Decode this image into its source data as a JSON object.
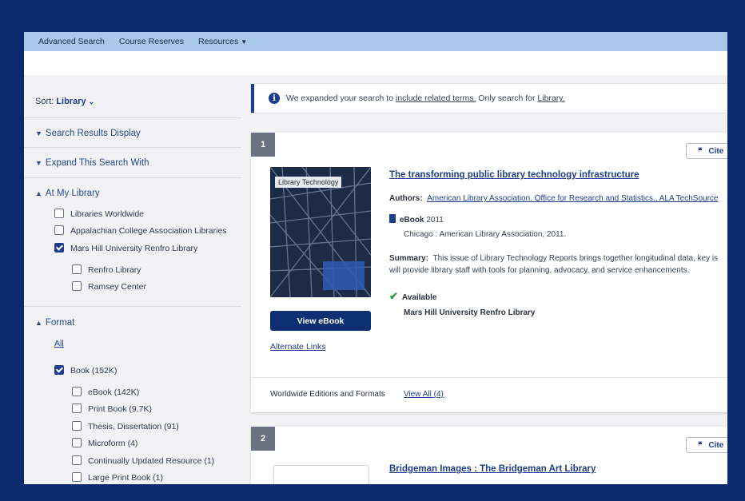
{
  "topnav": {
    "items": [
      "Advanced Search",
      "Course Reserves",
      "Resources"
    ]
  },
  "sidebar": {
    "sort_label": "Sort:",
    "sort_value": "Library",
    "search_results_display": "Search Results Display",
    "expand_search": "Expand This Search With",
    "at_my_library": {
      "heading": "At My Library",
      "options": [
        {
          "label": "Libraries Worldwide",
          "checked": false
        },
        {
          "label": "Appalachian College Association Libraries",
          "checked": false
        },
        {
          "label": "Mars Hill University Renfro Library",
          "checked": true
        },
        {
          "label": "Renfro Library",
          "checked": false
        },
        {
          "label": "Ramsey Center",
          "checked": false
        }
      ]
    },
    "format": {
      "heading": "Format",
      "all_link": "All",
      "options": [
        {
          "label": "Book (152K)",
          "checked": true
        },
        {
          "label": "eBook (142K)",
          "checked": false
        },
        {
          "label": "Print Book (9.7K)",
          "checked": false
        },
        {
          "label": "Thesis, Dissertation (91)",
          "checked": false
        },
        {
          "label": "Microform (4)",
          "checked": false
        },
        {
          "label": "Continually Updated Resource (1)",
          "checked": false
        },
        {
          "label": "Large Print Book (1)",
          "checked": false
        }
      ]
    }
  },
  "notice": {
    "prefix": "We expanded your search to",
    "link1": "include related terms.",
    "middle": "Only search for",
    "link2": "Library."
  },
  "results": [
    {
      "number": "1",
      "cite": "Cite",
      "cover_label": "Library Technology",
      "title": "The transforming public library technology infrastructure",
      "authors_label": "Authors:",
      "authors": "American Library Association. Office for Research and Statistics., ALA TechSource",
      "format_line": "eBook",
      "year": "2011",
      "publisher": "Chicago : American Library Association, 2011.",
      "summary_label": "Summary:",
      "summary_line1": "This issue of Library Technology Reports brings together longitudinal data, key is",
      "summary_line2": "will provide library staff with tools for planning, advocacy, and service enhancements.",
      "availability": "Available",
      "holding_library": "Mars Hill University Renfro Library",
      "view_button": "View eBook",
      "alternate_links": "Alternate Links",
      "editions_label": "Worldwide Editions and Formats",
      "view_all": "View All (4)"
    },
    {
      "number": "2",
      "cite": "Cite",
      "title": "Bridgeman Images : The Bridgeman Art Library"
    }
  ],
  "colors": {
    "frame": "#0b2a6e",
    "topnav": "#a9c7e8",
    "accent": "#1d3d8c",
    "available": "#2e9a3b"
  }
}
